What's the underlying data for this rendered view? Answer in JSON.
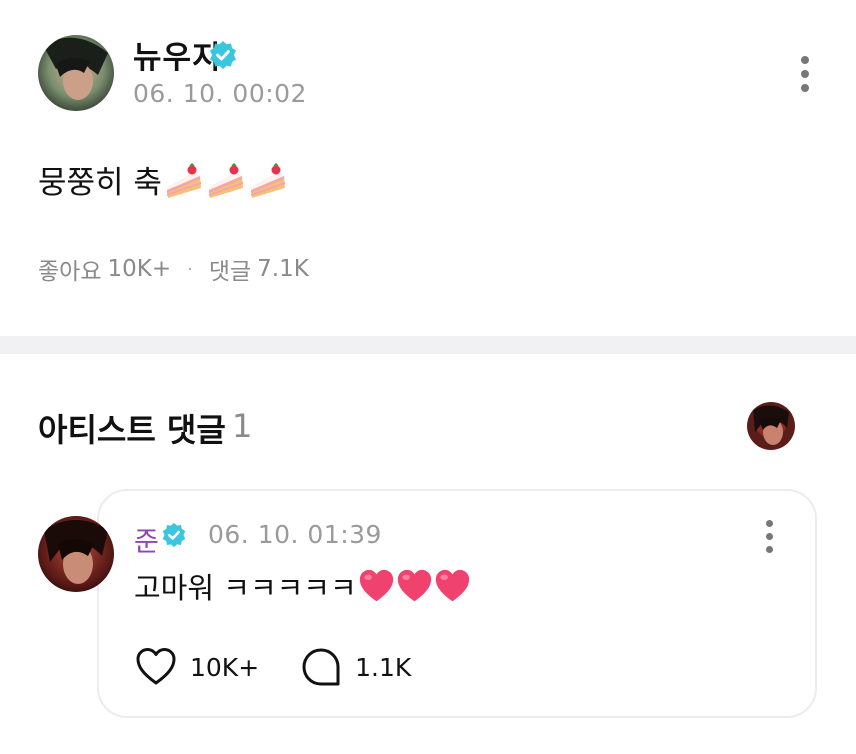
{
  "post": {
    "author": "뉴우지",
    "timestamp": "06. 10. 00:02",
    "body_text": "뭉쭝히 축",
    "emoji": [
      "cake",
      "cake",
      "cake"
    ],
    "likes_label": "좋아요",
    "likes_count": "10K+",
    "separator": "·",
    "comments_label": "댓글",
    "comments_count": "7.1K"
  },
  "artist_comments": {
    "title": "아티스트 댓글",
    "count": "1"
  },
  "comment": {
    "author": "준",
    "timestamp": "06. 10. 01:39",
    "body_text": "고마워 ㅋㅋㅋㅋㅋ",
    "emoji": [
      "heart",
      "heart",
      "heart"
    ],
    "likes_count": "10K+",
    "replies_count": "1.1K"
  },
  "colors": {
    "verified": "#3bc6e0",
    "artist_name": "#8e44b5",
    "muted_text": "#9a9a9a",
    "divider": "#f1f1f3",
    "heart": "#f0426e"
  }
}
